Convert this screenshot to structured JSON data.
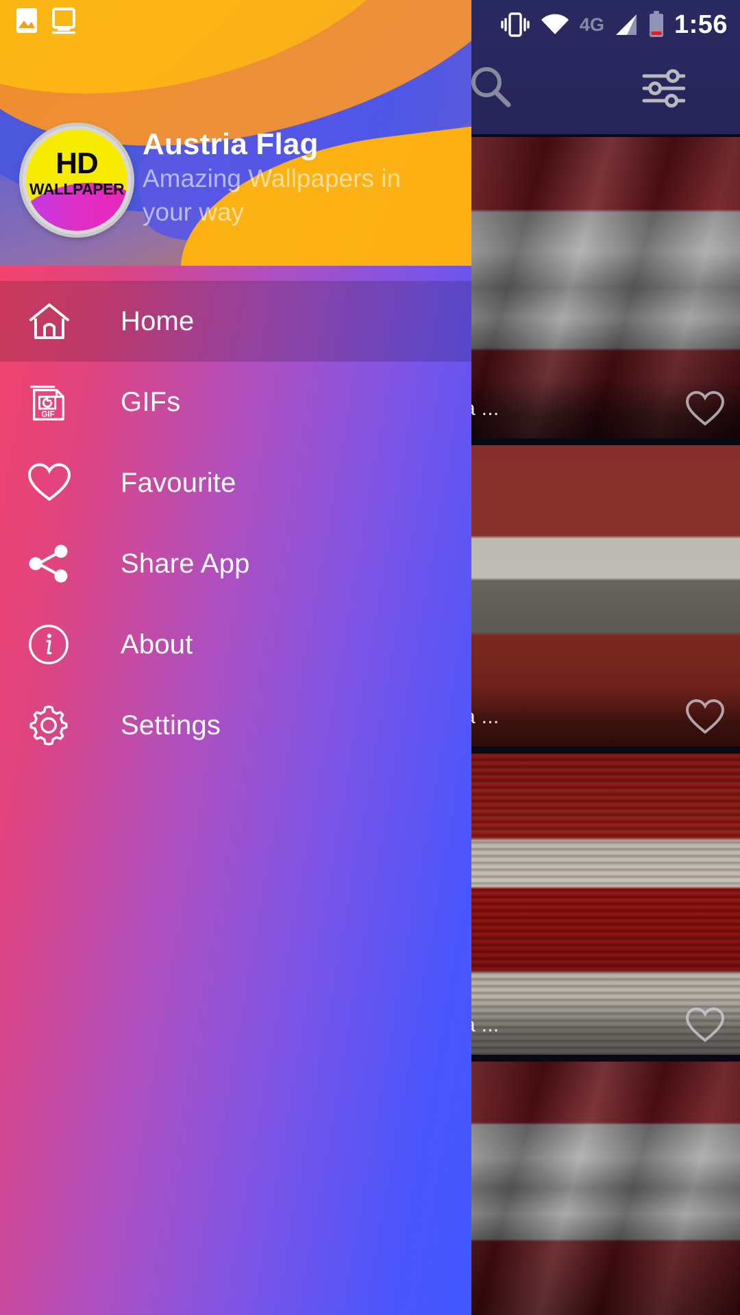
{
  "status_bar": {
    "icons_left": [
      "image-icon",
      "screenshot-icon"
    ],
    "icons_right": [
      "vibrate-icon",
      "wifi-icon",
      "signal-icon",
      "battery-icon"
    ],
    "network_label": "4G",
    "time": "1:56"
  },
  "app": {
    "toolbar": {
      "search_icon": "search-icon",
      "filter_icon": "filter-sliders-icon"
    },
    "wallpapers": [
      {
        "caption": "ia ...",
        "favourite_icon": "heart-outline-icon",
        "style": "silk"
      },
      {
        "caption": "ia ...",
        "favourite_icon": "heart-outline-icon",
        "style": "matte"
      },
      {
        "caption": "ia ...",
        "favourite_icon": "heart-outline-icon",
        "style": "wood"
      }
    ]
  },
  "drawer": {
    "header": {
      "logo": {
        "line1": "HD",
        "line2": "WALLPAPER"
      },
      "title": "Austria Flag",
      "subtitle": "Amazing Wallpapers in your way"
    },
    "items": [
      {
        "label": "Home",
        "icon": "home-icon",
        "selected": true
      },
      {
        "label": "GIFs",
        "icon": "gif-file-icon",
        "selected": false
      },
      {
        "label": "Favourite",
        "icon": "heart-icon",
        "selected": false
      },
      {
        "label": "Share App",
        "icon": "share-icon",
        "selected": false
      },
      {
        "label": "About",
        "icon": "info-icon",
        "selected": false
      },
      {
        "label": "Settings",
        "icon": "gear-icon",
        "selected": false
      }
    ]
  },
  "colors": {
    "drawer_gradient_start": "#FB4465",
    "drawer_gradient_end": "#4257FF",
    "toolbar_bg": "#2A2A62",
    "accent_yellow": "#FDB813",
    "accent_orange": "#EE8F33",
    "accent_blue": "#4F5AD8"
  }
}
